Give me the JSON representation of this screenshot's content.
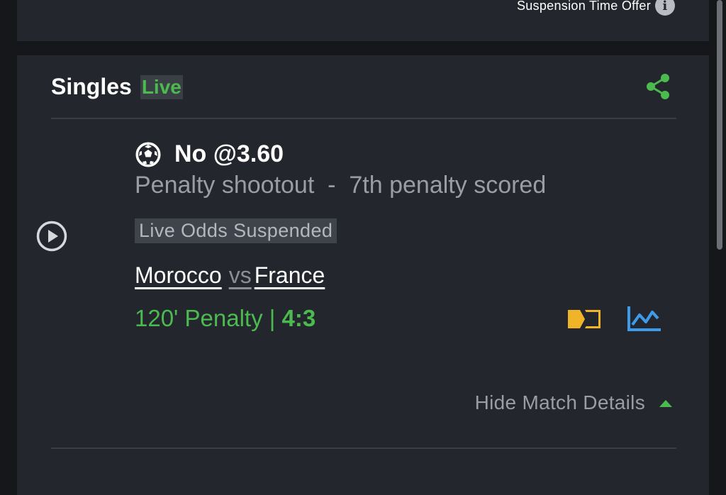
{
  "top_card": {
    "suspension_label": "Suspension Time Offer",
    "info_icon_glyph": "i"
  },
  "singles": {
    "title": "Singles",
    "live_label": "Live"
  },
  "bet": {
    "selection": "No @3.60",
    "market": "Penalty shootout  -  7th penalty scored",
    "status": "Live Odds Suspended",
    "home_team": "Morocco",
    "vs": "vs",
    "away_team": "France",
    "period": "120' Penalty | ",
    "score": "4:3"
  },
  "details_toggle": {
    "label": "Hide Match Details"
  },
  "icons": {
    "share": "share-icon",
    "play": "play-icon",
    "ball": "soccer-ball-icon",
    "tv": "live-stream-icon",
    "stats": "stats-chart-icon",
    "info": "info-icon",
    "caret": "caret-up-icon"
  },
  "colors": {
    "accent_green": "#4cbb4f",
    "card_bg": "#23262d",
    "page_bg": "#15171b",
    "tv_yellow": "#f0b429",
    "stats_blue": "#3d9be9"
  }
}
